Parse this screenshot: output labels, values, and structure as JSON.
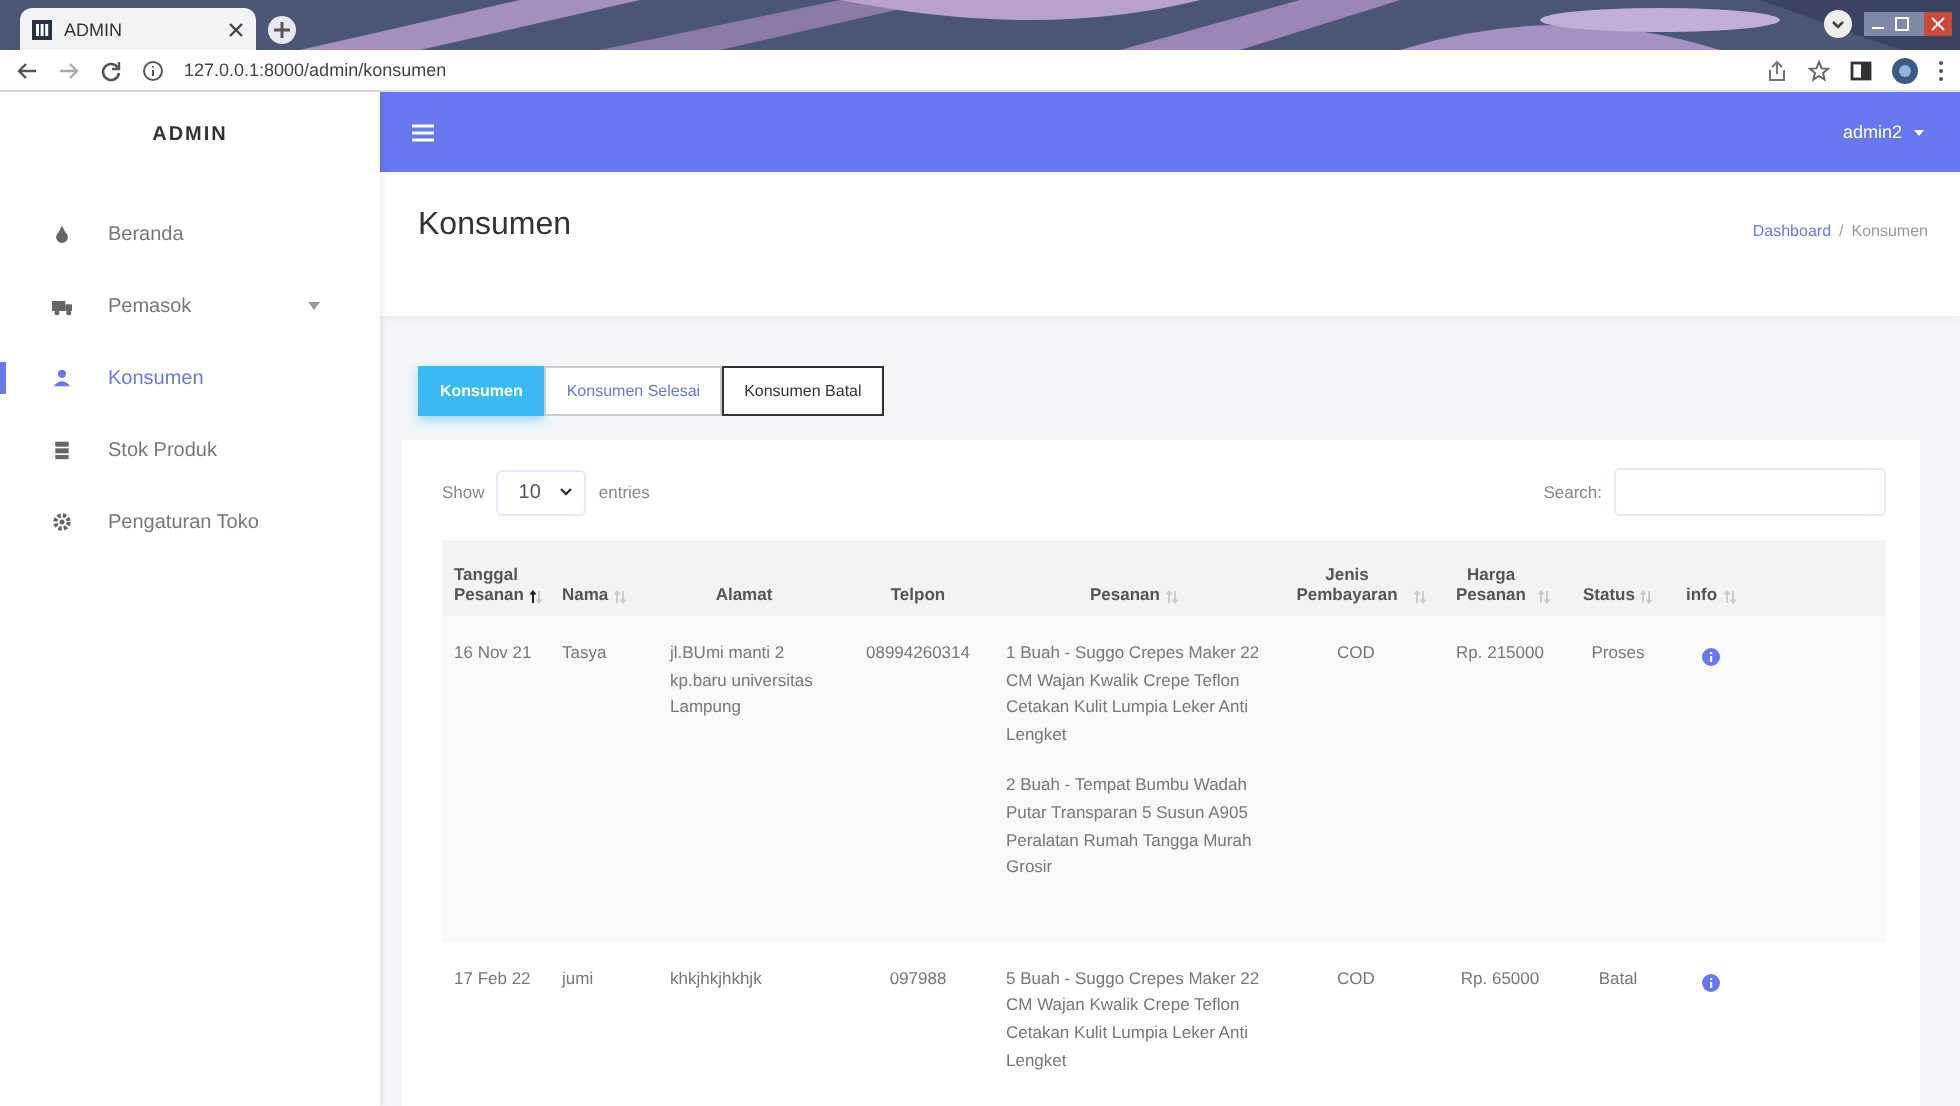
{
  "browser": {
    "tab_title": "ADMIN",
    "url": "127.0.0.1:8000/admin/konsumen"
  },
  "sidebar": {
    "brand": "ADMIN",
    "items": [
      {
        "label": "Beranda",
        "selected": false,
        "expandable": false
      },
      {
        "label": "Pemasok",
        "selected": false,
        "expandable": true
      },
      {
        "label": "Konsumen",
        "selected": true,
        "expandable": false
      },
      {
        "label": "Stok Produk",
        "selected": false,
        "expandable": false
      },
      {
        "label": "Pengaturan Toko",
        "selected": false,
        "expandable": false
      }
    ]
  },
  "topbar": {
    "user": "admin2"
  },
  "header": {
    "title": "Konsumen",
    "breadcrumb": [
      "Dashboard",
      "Konsumen"
    ],
    "breadcrumb_separator": "/"
  },
  "tabs": [
    {
      "label": "Konsumen",
      "selected": true
    },
    {
      "label": "Konsumen Selesai",
      "selected": false
    },
    {
      "label": "Konsumen Batal",
      "selected": false
    }
  ],
  "table_controls": {
    "show_label": "Show",
    "page_size": "10",
    "entries_label": "entries",
    "search_label": "Search:"
  },
  "table": {
    "columns": [
      {
        "label": "Tanggal Pesanan",
        "sortable": true,
        "sorted": true
      },
      {
        "label": "Nama",
        "sortable": true,
        "sorted": false
      },
      {
        "label": "Alamat",
        "sortable": false
      },
      {
        "label": "Telpon",
        "sortable": false
      },
      {
        "label": "Pesanan",
        "sortable": true,
        "sorted": false
      },
      {
        "label": "Jenis Pembayaran",
        "sortable": true,
        "sorted": false
      },
      {
        "label": "Harga Pesanan",
        "sortable": true,
        "sorted": false
      },
      {
        "label": "Status",
        "sortable": true,
        "sorted": false
      },
      {
        "label": "info",
        "sortable": true,
        "sorted": false
      }
    ],
    "rows": [
      {
        "tanggal": "16 Nov 21",
        "nama": "Tasya",
        "alamat": "jl.BUmi manti 2 kp.baru universitas Lampung",
        "telpon": "08994260314",
        "pesanan": [
          "1 Buah - Suggo Crepes Maker 22 CM Wajan Kwalik Crepe Teflon Cetakan Kulit Lumpia Leker Anti Lengket",
          "2 Buah - Tempat Bumbu Wadah Putar Transparan 5 Susun A905 Peralatan Rumah Tangga Murah Grosir"
        ],
        "pembayaran": "COD",
        "harga": "Rp. 215000",
        "status": "Proses"
      },
      {
        "tanggal": "17 Feb 22",
        "nama": "jumi",
        "alamat": "khkjhkjhkhjk",
        "telpon": "097988",
        "pesanan": [
          "5 Buah - Suggo Crepes Maker 22 CM Wajan Kwalik Crepe Teflon Cetakan Kulit Lumpia Leker Anti Lengket"
        ],
        "pembayaran": "COD",
        "harga": "Rp. 65000",
        "status": "Batal"
      }
    ]
  }
}
